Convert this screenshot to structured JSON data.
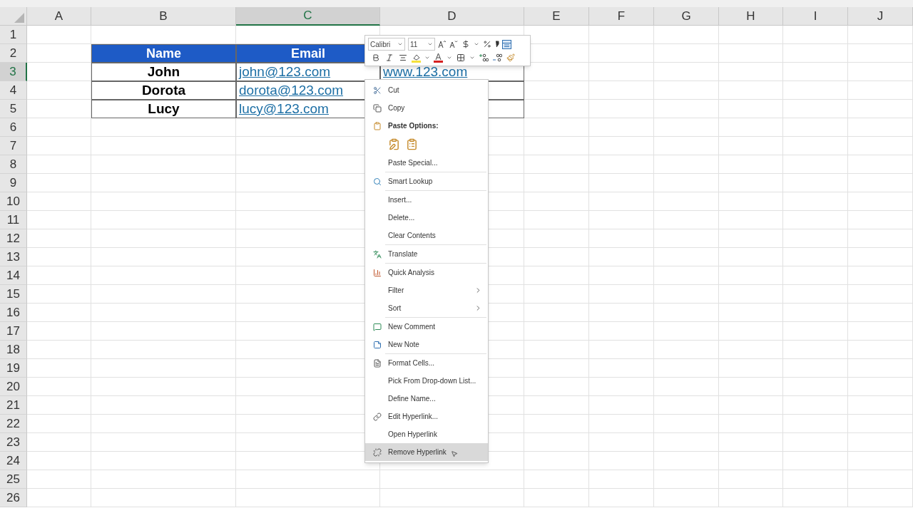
{
  "columns": [
    {
      "label": "A",
      "selected": false
    },
    {
      "label": "B",
      "selected": false
    },
    {
      "label": "C",
      "selected": true
    },
    {
      "label": "D",
      "selected": false
    },
    {
      "label": "E",
      "selected": false
    },
    {
      "label": "F",
      "selected": false
    },
    {
      "label": "G",
      "selected": false
    },
    {
      "label": "H",
      "selected": false
    },
    {
      "label": "I",
      "selected": false
    },
    {
      "label": "J",
      "selected": false
    }
  ],
  "rows": [
    {
      "label": "1",
      "selected": false
    },
    {
      "label": "2",
      "selected": false
    },
    {
      "label": "3",
      "selected": true
    },
    {
      "label": "4",
      "selected": false
    },
    {
      "label": "5",
      "selected": false
    },
    {
      "label": "6",
      "selected": false
    },
    {
      "label": "7",
      "selected": false
    },
    {
      "label": "8",
      "selected": false
    },
    {
      "label": "9",
      "selected": false
    },
    {
      "label": "10",
      "selected": false
    },
    {
      "label": "11",
      "selected": false
    },
    {
      "label": "12",
      "selected": false
    },
    {
      "label": "13",
      "selected": false
    },
    {
      "label": "14",
      "selected": false
    },
    {
      "label": "15",
      "selected": false
    },
    {
      "label": "16",
      "selected": false
    },
    {
      "label": "17",
      "selected": false
    },
    {
      "label": "18",
      "selected": false
    },
    {
      "label": "19",
      "selected": false
    },
    {
      "label": "20",
      "selected": false
    },
    {
      "label": "21",
      "selected": false
    },
    {
      "label": "22",
      "selected": false
    },
    {
      "label": "23",
      "selected": false
    },
    {
      "label": "24",
      "selected": false
    },
    {
      "label": "25",
      "selected": false
    },
    {
      "label": "26",
      "selected": false
    }
  ],
  "data_table": {
    "header": [
      "Name",
      "Email"
    ],
    "records": [
      {
        "name": "John",
        "email": "john@123.com",
        "website": "www.123.com"
      },
      {
        "name": "Dorota",
        "email": "dorota@123.com"
      },
      {
        "name": "Lucy",
        "email": "lucy@123.com"
      }
    ]
  },
  "mini_toolbar": {
    "font": "Calibri",
    "size": "11"
  },
  "context_menu": [
    {
      "kind": "item",
      "label": "Cut",
      "highlighted": false
    },
    {
      "kind": "item",
      "label": "Copy",
      "highlighted": false
    },
    {
      "kind": "header",
      "label": "Paste Options:"
    },
    {
      "kind": "paste-icons"
    },
    {
      "kind": "item",
      "label": "Paste Special...",
      "highlighted": false
    },
    {
      "kind": "separator"
    },
    {
      "kind": "item",
      "label": "Smart Lookup",
      "highlighted": false
    },
    {
      "kind": "separator"
    },
    {
      "kind": "item",
      "label": "Insert...",
      "highlighted": false
    },
    {
      "kind": "item",
      "label": "Delete...",
      "highlighted": false
    },
    {
      "kind": "item",
      "label": "Clear Contents",
      "highlighted": false
    },
    {
      "kind": "separator"
    },
    {
      "kind": "item",
      "label": "Translate",
      "highlighted": false
    },
    {
      "kind": "separator"
    },
    {
      "kind": "item",
      "label": "Quick Analysis",
      "highlighted": false
    },
    {
      "kind": "submenu",
      "label": "Filter",
      "highlighted": false
    },
    {
      "kind": "submenu",
      "label": "Sort",
      "highlighted": false
    },
    {
      "kind": "separator"
    },
    {
      "kind": "item",
      "label": "New Comment",
      "highlighted": false
    },
    {
      "kind": "item",
      "label": "New Note",
      "highlighted": false
    },
    {
      "kind": "separator"
    },
    {
      "kind": "item",
      "label": "Format Cells...",
      "highlighted": false
    },
    {
      "kind": "item",
      "label": "Pick From Drop-down List...",
      "highlighted": false
    },
    {
      "kind": "item",
      "label": "Define Name...",
      "highlighted": false
    },
    {
      "kind": "item",
      "label": "Edit Hyperlink...",
      "highlighted": false
    },
    {
      "kind": "item",
      "label": "Open Hyperlink",
      "highlighted": false
    },
    {
      "kind": "item",
      "label": "Remove Hyperlink",
      "highlighted": true
    }
  ]
}
